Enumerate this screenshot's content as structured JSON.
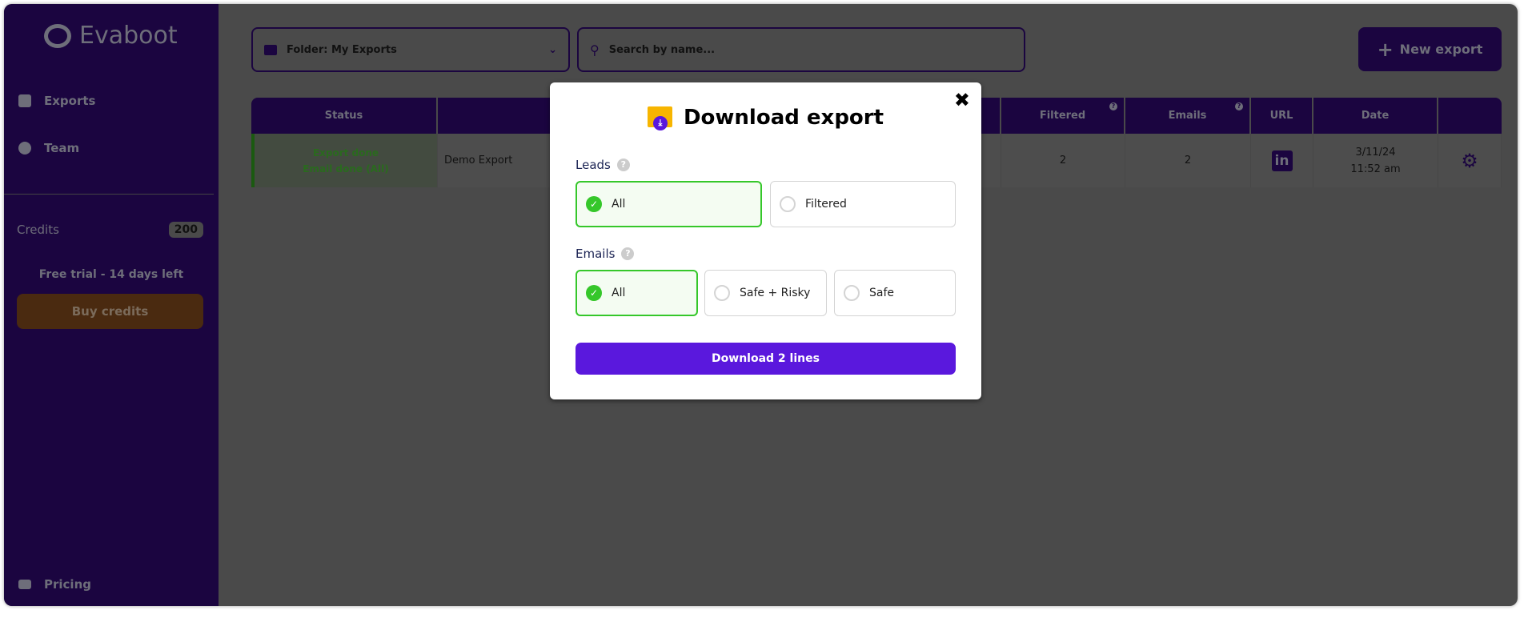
{
  "app": {
    "brand": "Evaboot"
  },
  "sidebar": {
    "items": [
      {
        "label": "Exports",
        "icon": "export-icon"
      },
      {
        "label": "Team",
        "icon": "team-icon"
      }
    ],
    "credits_label": "Credits",
    "credits_value": "200",
    "trial": "Free trial - 14 days left",
    "buy_label": "Buy credits",
    "pricing_label": "Pricing"
  },
  "toolbar": {
    "folder": "Folder: My Exports",
    "search_placeholder": "Search by name...",
    "new_export": "New export"
  },
  "table": {
    "headers": [
      "Status",
      "",
      "",
      "",
      "Filtered",
      "Emails",
      "URL",
      "Date",
      ""
    ],
    "rows": [
      {
        "status_1": "Export done",
        "status_2": "Email done (All)",
        "name": "Demo Export",
        "filtered": "2",
        "emails": "2",
        "url_icon": "linkedin-icon",
        "date": "3/11/24",
        "time": "11:52 am"
      }
    ]
  },
  "modal": {
    "title": "Download export",
    "leads_label": "Leads",
    "leads_options": [
      "All",
      "Filtered"
    ],
    "leads_selected": "All",
    "emails_label": "Emails",
    "emails_options": [
      "All",
      "Safe + Risky",
      "Safe"
    ],
    "emails_selected": "All",
    "download_label": "Download 2 lines"
  },
  "colors": {
    "sidebar": "#1b0540",
    "accent": "#5a18dd",
    "selected": "#35c72a",
    "folder": "#f7b500"
  }
}
